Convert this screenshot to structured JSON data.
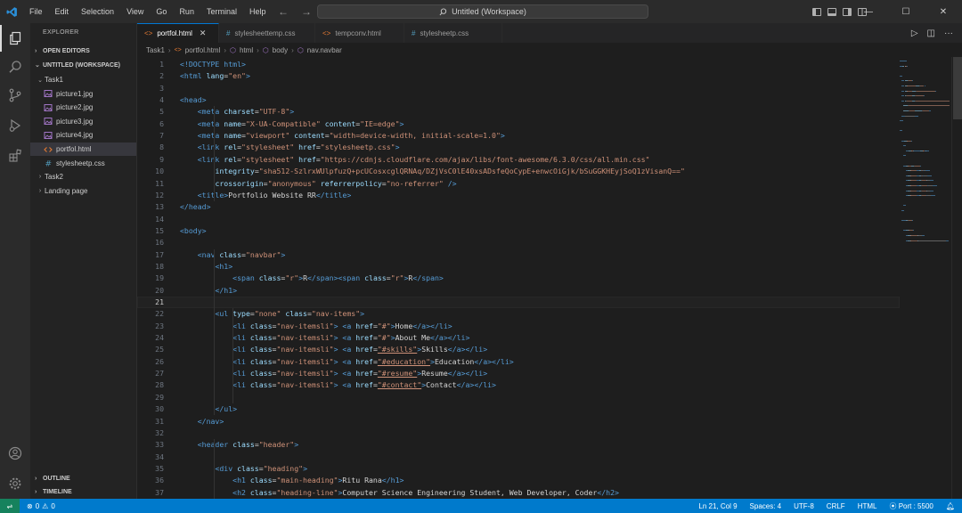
{
  "menu": [
    "File",
    "Edit",
    "Selection",
    "View",
    "Go",
    "Run",
    "Terminal",
    "Help"
  ],
  "window_title": "Untitled (Workspace)",
  "sidebar": {
    "title": "EXPLORER",
    "open_editors": "OPEN EDITORS",
    "workspace": "UNTITLED (WORKSPACE)",
    "items": [
      {
        "label": "Task1",
        "type": "folder",
        "expanded": true,
        "indent": 1
      },
      {
        "label": "picture1.jpg",
        "type": "image",
        "indent": 2
      },
      {
        "label": "picture2.jpg",
        "type": "image",
        "indent": 2
      },
      {
        "label": "picture3.jpg",
        "type": "image",
        "indent": 2
      },
      {
        "label": "picture4.jpg",
        "type": "image",
        "indent": 2
      },
      {
        "label": "portfol.html",
        "type": "html",
        "indent": 2,
        "selected": true
      },
      {
        "label": "stylesheetp.css",
        "type": "css",
        "indent": 2
      },
      {
        "label": "Task2",
        "type": "folder",
        "expanded": false,
        "indent": 1
      },
      {
        "label": "Landing page",
        "type": "folder",
        "expanded": false,
        "indent": 1
      }
    ],
    "outline": "OUTLINE",
    "timeline": "TIMELINE"
  },
  "tabs": [
    {
      "label": "portfol.html",
      "icon": "<>",
      "active": true
    },
    {
      "label": "stylesheettemp.css",
      "icon": "#",
      "active": false
    },
    {
      "label": "tempconv.html",
      "icon": "<>",
      "active": false
    },
    {
      "label": "stylesheetp.css",
      "icon": "#",
      "active": false
    }
  ],
  "breadcrumb": [
    "Task1",
    "portfol.html",
    "html",
    "body",
    "nav.navbar"
  ],
  "editor": {
    "current_line": 21,
    "lines": [
      {
        "n": 1,
        "t": [
          [
            "tag",
            "<!DOCTYPE html>"
          ]
        ]
      },
      {
        "n": 2,
        "t": [
          [
            "tag",
            "<html "
          ],
          [
            "attr",
            "lang"
          ],
          [
            "txt",
            "="
          ],
          [
            "str",
            "\"en\""
          ],
          [
            "tag",
            ">"
          ]
        ]
      },
      {
        "n": 3,
        "t": []
      },
      {
        "n": 4,
        "t": [
          [
            "tag",
            "<head>"
          ]
        ]
      },
      {
        "n": 5,
        "t": [
          [
            "txt",
            "    "
          ],
          [
            "tag",
            "<meta "
          ],
          [
            "attr",
            "charset"
          ],
          [
            "txt",
            "="
          ],
          [
            "str",
            "\"UTF-8\""
          ],
          [
            "tag",
            ">"
          ]
        ]
      },
      {
        "n": 6,
        "t": [
          [
            "txt",
            "    "
          ],
          [
            "tag",
            "<meta "
          ],
          [
            "attr",
            "name"
          ],
          [
            "txt",
            "="
          ],
          [
            "str",
            "\"X-UA-Compatible\""
          ],
          [
            "attr",
            " content"
          ],
          [
            "txt",
            "="
          ],
          [
            "str",
            "\"IE=edge\""
          ],
          [
            "tag",
            ">"
          ]
        ]
      },
      {
        "n": 7,
        "t": [
          [
            "txt",
            "    "
          ],
          [
            "tag",
            "<meta "
          ],
          [
            "attr",
            "name"
          ],
          [
            "txt",
            "="
          ],
          [
            "str",
            "\"viewport\""
          ],
          [
            "attr",
            " content"
          ],
          [
            "txt",
            "="
          ],
          [
            "str",
            "\"width=device-width, initial-scale=1.0\""
          ],
          [
            "tag",
            ">"
          ]
        ]
      },
      {
        "n": 8,
        "t": [
          [
            "txt",
            "    "
          ],
          [
            "tag",
            "<link "
          ],
          [
            "attr",
            "rel"
          ],
          [
            "txt",
            "="
          ],
          [
            "str",
            "\"stylesheet\""
          ],
          [
            "attr",
            " href"
          ],
          [
            "txt",
            "="
          ],
          [
            "str",
            "\"stylesheetp.css\""
          ],
          [
            "tag",
            ">"
          ]
        ]
      },
      {
        "n": 9,
        "t": [
          [
            "txt",
            "    "
          ],
          [
            "tag",
            "<link "
          ],
          [
            "attr",
            "rel"
          ],
          [
            "txt",
            "="
          ],
          [
            "str",
            "\"stylesheet\""
          ],
          [
            "attr",
            " href"
          ],
          [
            "txt",
            "="
          ],
          [
            "str",
            "\"https://cdnjs.cloudflare.com/ajax/libs/font-awesome/6.3.0/css/all.min.css\""
          ]
        ]
      },
      {
        "n": 10,
        "t": [
          [
            "txt",
            "        "
          ],
          [
            "attr",
            "integrity"
          ],
          [
            "txt",
            "="
          ],
          [
            "str",
            "\"sha512-SzlrxWUlpfuzQ+pcUCosxcglQRNAq/DZjVsC0lE40xsADsfeQoCypE+enwcOiGjk/bSuGGKHEyjSoQ1zVisanQ==\""
          ]
        ]
      },
      {
        "n": 11,
        "t": [
          [
            "txt",
            "        "
          ],
          [
            "attr",
            "crossorigin"
          ],
          [
            "txt",
            "="
          ],
          [
            "str",
            "\"anonymous\""
          ],
          [
            "attr",
            " referrerpolicy"
          ],
          [
            "txt",
            "="
          ],
          [
            "str",
            "\"no-referrer\""
          ],
          [
            "tag",
            " />"
          ]
        ]
      },
      {
        "n": 12,
        "t": [
          [
            "txt",
            "    "
          ],
          [
            "tag",
            "<title>"
          ],
          [
            "txt",
            "Portfolio Website RR"
          ],
          [
            "tag",
            "</title>"
          ]
        ]
      },
      {
        "n": 13,
        "t": [
          [
            "tag",
            "</head>"
          ]
        ]
      },
      {
        "n": 14,
        "t": []
      },
      {
        "n": 15,
        "t": [
          [
            "tag",
            "<body>"
          ]
        ]
      },
      {
        "n": 16,
        "t": []
      },
      {
        "n": 17,
        "t": [
          [
            "txt",
            "    "
          ],
          [
            "tag",
            "<nav "
          ],
          [
            "attr",
            "class"
          ],
          [
            "txt",
            "="
          ],
          [
            "str",
            "\"navbar\""
          ],
          [
            "tag",
            ">"
          ]
        ]
      },
      {
        "n": 18,
        "t": [
          [
            "txt",
            "        "
          ],
          [
            "tag",
            "<h1>"
          ]
        ]
      },
      {
        "n": 19,
        "t": [
          [
            "txt",
            "            "
          ],
          [
            "tag",
            "<span "
          ],
          [
            "attr",
            "class"
          ],
          [
            "txt",
            "="
          ],
          [
            "str",
            "\"r\""
          ],
          [
            "tag",
            ">"
          ],
          [
            "txt",
            "R"
          ],
          [
            "tag",
            "</span><span "
          ],
          [
            "attr",
            "class"
          ],
          [
            "txt",
            "="
          ],
          [
            "str",
            "\"r\""
          ],
          [
            "tag",
            ">"
          ],
          [
            "txt",
            "R"
          ],
          [
            "tag",
            "</span>"
          ]
        ]
      },
      {
        "n": 20,
        "t": [
          [
            "txt",
            "        "
          ],
          [
            "tag",
            "</h1>"
          ]
        ]
      },
      {
        "n": 21,
        "t": []
      },
      {
        "n": 22,
        "t": [
          [
            "txt",
            "        "
          ],
          [
            "tag",
            "<ul "
          ],
          [
            "attr",
            "type"
          ],
          [
            "txt",
            "="
          ],
          [
            "str",
            "\"none\""
          ],
          [
            "attr",
            " class"
          ],
          [
            "txt",
            "="
          ],
          [
            "str",
            "\"nav-items\""
          ],
          [
            "tag",
            ">"
          ]
        ]
      },
      {
        "n": 23,
        "t": [
          [
            "txt",
            "            "
          ],
          [
            "tag",
            "<li "
          ],
          [
            "attr",
            "class"
          ],
          [
            "txt",
            "="
          ],
          [
            "str",
            "\"nav-itemsli\""
          ],
          [
            "tag",
            "> <a "
          ],
          [
            "attr",
            "href"
          ],
          [
            "txt",
            "="
          ],
          [
            "str",
            "\"#\""
          ],
          [
            "tag",
            ">"
          ],
          [
            "txt",
            "Home"
          ],
          [
            "tag",
            "</a></li>"
          ]
        ]
      },
      {
        "n": 24,
        "t": [
          [
            "txt",
            "            "
          ],
          [
            "tag",
            "<li "
          ],
          [
            "attr",
            "class"
          ],
          [
            "txt",
            "="
          ],
          [
            "str",
            "\"nav-itemsli\""
          ],
          [
            "tag",
            "> <a "
          ],
          [
            "attr",
            "href"
          ],
          [
            "txt",
            "="
          ],
          [
            "str",
            "\"#\""
          ],
          [
            "tag",
            ">"
          ],
          [
            "txt",
            "About Me"
          ],
          [
            "tag",
            "</a></li>"
          ]
        ]
      },
      {
        "n": 25,
        "t": [
          [
            "txt",
            "            "
          ],
          [
            "tag",
            "<li "
          ],
          [
            "attr",
            "class"
          ],
          [
            "txt",
            "="
          ],
          [
            "str",
            "\"nav-itemsli\""
          ],
          [
            "tag",
            "> <a "
          ],
          [
            "attr",
            "href"
          ],
          [
            "txt",
            "="
          ],
          [
            "und",
            "\"#skills\""
          ],
          [
            "tag",
            ">"
          ],
          [
            "txt",
            "Skills"
          ],
          [
            "tag",
            "</a></li>"
          ]
        ]
      },
      {
        "n": 26,
        "t": [
          [
            "txt",
            "            "
          ],
          [
            "tag",
            "<li "
          ],
          [
            "attr",
            "class"
          ],
          [
            "txt",
            "="
          ],
          [
            "str",
            "\"nav-itemsli\""
          ],
          [
            "tag",
            "> <a "
          ],
          [
            "attr",
            "href"
          ],
          [
            "txt",
            "="
          ],
          [
            "und",
            "\"#education\""
          ],
          [
            "tag",
            ">"
          ],
          [
            "txt",
            "Education"
          ],
          [
            "tag",
            "</a></li>"
          ]
        ]
      },
      {
        "n": 27,
        "t": [
          [
            "txt",
            "            "
          ],
          [
            "tag",
            "<li "
          ],
          [
            "attr",
            "class"
          ],
          [
            "txt",
            "="
          ],
          [
            "str",
            "\"nav-itemsli\""
          ],
          [
            "tag",
            "> <a "
          ],
          [
            "attr",
            "href"
          ],
          [
            "txt",
            "="
          ],
          [
            "und",
            "\"#resume\""
          ],
          [
            "tag",
            ">"
          ],
          [
            "txt",
            "Resume"
          ],
          [
            "tag",
            "</a></li>"
          ]
        ]
      },
      {
        "n": 28,
        "t": [
          [
            "txt",
            "            "
          ],
          [
            "tag",
            "<li "
          ],
          [
            "attr",
            "class"
          ],
          [
            "txt",
            "="
          ],
          [
            "str",
            "\"nav-itemsli\""
          ],
          [
            "tag",
            "> <a "
          ],
          [
            "attr",
            "href"
          ],
          [
            "txt",
            "="
          ],
          [
            "und",
            "\"#contact\""
          ],
          [
            "tag",
            ">"
          ],
          [
            "txt",
            "Contact"
          ],
          [
            "tag",
            "</a></li>"
          ]
        ]
      },
      {
        "n": 29,
        "t": []
      },
      {
        "n": 30,
        "t": [
          [
            "txt",
            "        "
          ],
          [
            "tag",
            "</ul>"
          ]
        ]
      },
      {
        "n": 31,
        "t": [
          [
            "txt",
            "    "
          ],
          [
            "tag",
            "</nav>"
          ]
        ]
      },
      {
        "n": 32,
        "t": []
      },
      {
        "n": 33,
        "t": [
          [
            "txt",
            "    "
          ],
          [
            "tag",
            "<header "
          ],
          [
            "attr",
            "class"
          ],
          [
            "txt",
            "="
          ],
          [
            "str",
            "\"header\""
          ],
          [
            "tag",
            ">"
          ]
        ]
      },
      {
        "n": 34,
        "t": []
      },
      {
        "n": 35,
        "t": [
          [
            "txt",
            "        "
          ],
          [
            "tag",
            "<div "
          ],
          [
            "attr",
            "class"
          ],
          [
            "txt",
            "="
          ],
          [
            "str",
            "\"heading\""
          ],
          [
            "tag",
            ">"
          ]
        ]
      },
      {
        "n": 36,
        "t": [
          [
            "txt",
            "            "
          ],
          [
            "tag",
            "<h1 "
          ],
          [
            "attr",
            "class"
          ],
          [
            "txt",
            "="
          ],
          [
            "str",
            "\"main-heading\""
          ],
          [
            "tag",
            ">"
          ],
          [
            "txt",
            "Ritu Rana"
          ],
          [
            "tag",
            "</h1>"
          ]
        ]
      },
      {
        "n": 37,
        "t": [
          [
            "txt",
            "            "
          ],
          [
            "tag",
            "<h2 "
          ],
          [
            "attr",
            "class"
          ],
          [
            "txt",
            "="
          ],
          [
            "str",
            "\"heading-line\""
          ],
          [
            "tag",
            ">"
          ],
          [
            "txt",
            "Computer Science Engineering Student, Web Developer, Coder"
          ],
          [
            "tag",
            "</h2>"
          ]
        ]
      }
    ]
  },
  "statusbar": {
    "errors": "0",
    "warnings": "0",
    "position": "Ln 21, Col 9",
    "spaces": "Spaces: 4",
    "encoding": "UTF-8",
    "eol": "CRLF",
    "language": "HTML",
    "port": "Port : 5500"
  },
  "colors": {
    "accent": "#007acc",
    "tag": "#569cd6",
    "attr": "#9cdcfe",
    "string": "#ce9178",
    "html_icon": "#e37933",
    "css_icon": "#519aba",
    "image_icon": "#a074c4"
  }
}
